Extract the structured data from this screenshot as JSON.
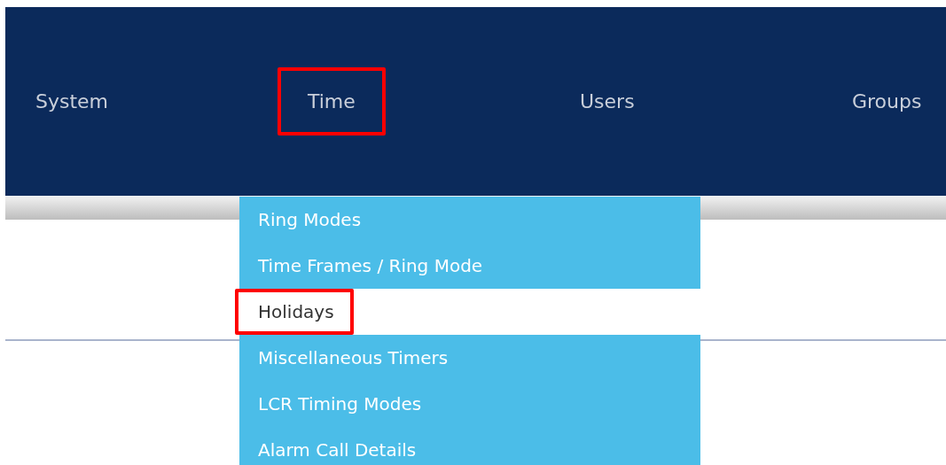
{
  "nav": [
    {
      "label": "System",
      "highlighted": false
    },
    {
      "label": "Time",
      "highlighted": true
    },
    {
      "label": "Users",
      "highlighted": false
    },
    {
      "label": "Groups",
      "highlighted": false
    }
  ],
  "dropdown": [
    {
      "label": "Ring Modes",
      "selected": false,
      "highlighted": false
    },
    {
      "label": "Time Frames / Ring Mode",
      "selected": false,
      "highlighted": false
    },
    {
      "label": "Holidays",
      "selected": true,
      "highlighted": true
    },
    {
      "label": "Miscellaneous Timers",
      "selected": false,
      "highlighted": false
    },
    {
      "label": "LCR Timing Modes",
      "selected": false,
      "highlighted": false
    },
    {
      "label": "Alarm Call Details",
      "selected": false,
      "highlighted": false
    }
  ]
}
